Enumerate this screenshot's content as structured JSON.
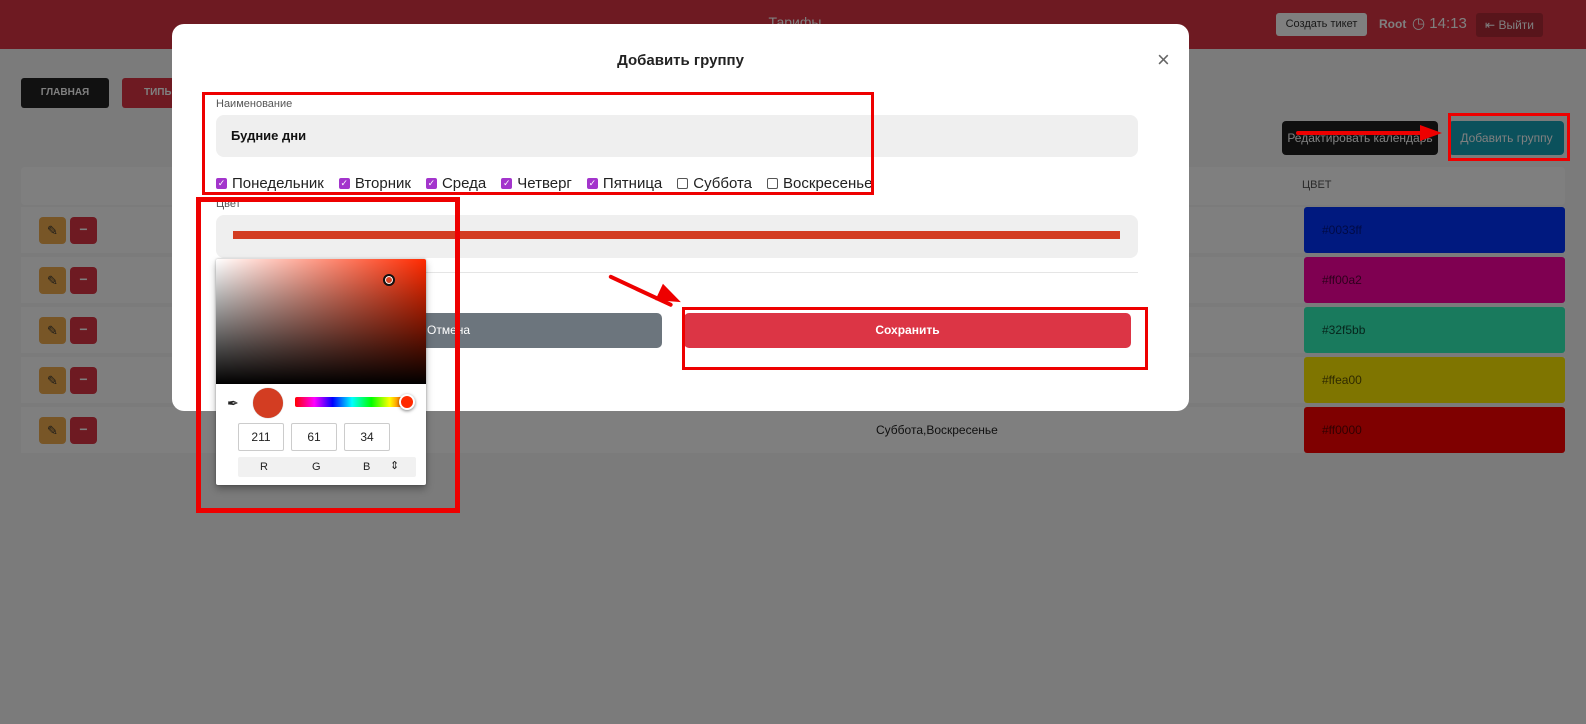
{
  "topbar": {
    "title": "Тарифы",
    "create_ticket": "Создать тикет",
    "user": "Root",
    "time": "14:13",
    "logout": "Выйти"
  },
  "nav": {
    "main": "ГЛАВНАЯ",
    "types": "ТИПЫ"
  },
  "actions": {
    "edit_calendar": "Редактировать календарь",
    "add_group": "Добавить группу"
  },
  "table": {
    "color_header": "ЦВЕТ",
    "rows": [
      {
        "days": "",
        "color_label": "#0033ff",
        "color": "#0033ff"
      },
      {
        "days": "",
        "color_label": "#ff00a2",
        "color": "#ff00a2"
      },
      {
        "days": "",
        "color_label": "#32f5bb",
        "color": "#32f5bb"
      },
      {
        "days": "",
        "color_label": "#ffea00",
        "color": "#ffea00"
      },
      {
        "days": "Суббота,Воскресенье",
        "color_label": "#ff0000",
        "color": "#ff0000"
      }
    ]
  },
  "modal": {
    "title": "Добавить группу",
    "name_label": "Наименование",
    "name_value": "Будние дни",
    "days": [
      {
        "label": "Понедельник",
        "checked": true
      },
      {
        "label": "Вторник",
        "checked": true
      },
      {
        "label": "Среда",
        "checked": true
      },
      {
        "label": "Четверг",
        "checked": true
      },
      {
        "label": "Пятница",
        "checked": true
      },
      {
        "label": "Суббота",
        "checked": false
      },
      {
        "label": "Воскресенье",
        "checked": false
      }
    ],
    "color_label": "Цвет",
    "color_value": "#d33d22",
    "cancel": "Отмена",
    "save": "Сохранить"
  },
  "picker": {
    "r": "211",
    "g": "61",
    "b": "34",
    "r_label": "R",
    "g_label": "G",
    "b_label": "B",
    "icons": [
      "eyedropper-icon",
      "chevron-updown-icon"
    ]
  }
}
